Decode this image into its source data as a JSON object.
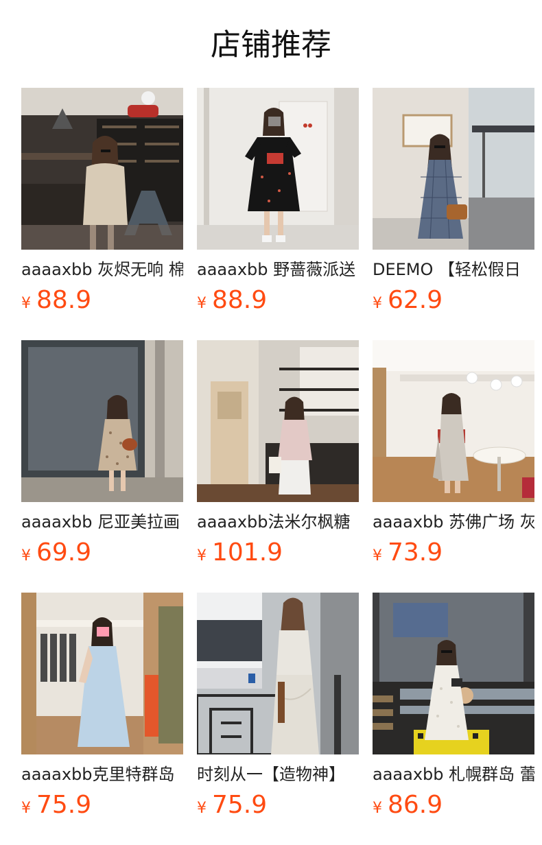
{
  "page_title": "店铺推荐",
  "currency_symbol": "¥",
  "colors": {
    "price": "#ff4b12",
    "title": "#222222"
  },
  "products": [
    {
      "title": "aaaaxbb 灰烬无响 棉",
      "price": "88.9",
      "photo": "woman-in-beige-shirt-in-shop-photo"
    },
    {
      "title": "aaaaxbb 野蔷薇派送",
      "price": "88.9",
      "photo": "woman-in-black-dress-mirror-selfie-photo"
    },
    {
      "title": "DEEMO 【轻松假日",
      "price": "62.9",
      "photo": "woman-in-plaid-dress-street-photo"
    },
    {
      "title": "aaaaxbb 尼亚美拉画",
      "price": "69.9",
      "photo": "woman-in-polka-dot-dress-street-photo"
    },
    {
      "title": "aaaaxbb法米尔枫糖",
      "price": "101.9",
      "photo": "woman-in-pink-top-cafe-photo"
    },
    {
      "title": "aaaaxbb 苏佛广场 灰",
      "price": "73.9",
      "photo": "woman-in-grey-jumpsuit-cafe-photo"
    },
    {
      "title": "aaaaxbb克里特群岛",
      "price": "75.9",
      "photo": "woman-in-blue-dress-mirror-selfie-photo"
    },
    {
      "title": "时刻从一【造物神】",
      "price": "75.9",
      "photo": "woman-in-white-satin-dress-photo"
    },
    {
      "title": "aaaaxbb 札幌群岛 蕾",
      "price": "86.9",
      "photo": "woman-in-white-lace-dress-bench-photo"
    }
  ]
}
